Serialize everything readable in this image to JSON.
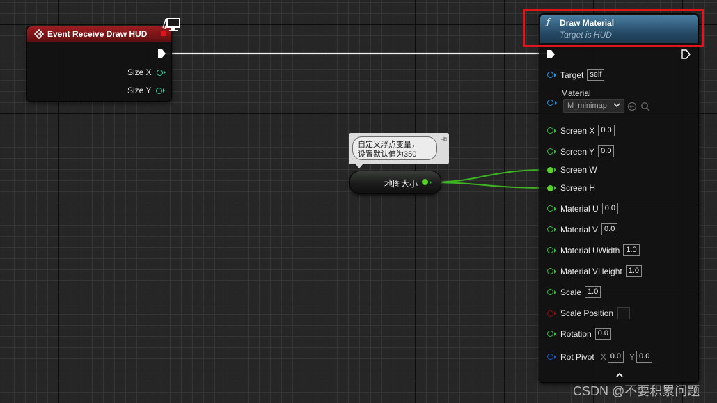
{
  "event_node": {
    "title": "Event Receive Draw HUD",
    "pins": [
      {
        "label": "Size X"
      },
      {
        "label": "Size Y"
      }
    ]
  },
  "comment_bubble": {
    "line1": "自定义浮点变量，",
    "line2": "设置默认值为350"
  },
  "variable_node": {
    "label": "地图大小"
  },
  "draw_material_node": {
    "title": "Draw Material",
    "subtitle": "Target is HUD",
    "target": {
      "label": "Target",
      "value": "self"
    },
    "material": {
      "label": "Material",
      "value": "M_minimap"
    },
    "pins": [
      {
        "label": "Screen X",
        "value": "0.0"
      },
      {
        "label": "Screen Y",
        "value": "0.0"
      },
      {
        "label": "Screen W",
        "value": ""
      },
      {
        "label": "Screen H",
        "value": ""
      },
      {
        "label": "Material U",
        "value": "0.0"
      },
      {
        "label": "Material V",
        "value": "0.0"
      },
      {
        "label": "Material UWidth",
        "value": "1.0"
      },
      {
        "label": "Material VHeight",
        "value": "1.0"
      },
      {
        "label": "Scale",
        "value": "1.0"
      },
      {
        "label": "Scale Position",
        "value": ""
      },
      {
        "label": "Rotation",
        "value": "0.0"
      }
    ],
    "rot_pivot": {
      "label": "Rot Pivot",
      "x_label": "X",
      "x_value": "0.0",
      "y_label": "Y",
      "y_value": "0.0"
    }
  },
  "watermark": "CSDN @不要积累问题",
  "colors": {
    "exec_wire": "#ffffff",
    "float_wire": "#3cb521",
    "highlight_box": "#e2141b",
    "event_header": "#7a1416",
    "function_header": "#2f5a78"
  }
}
